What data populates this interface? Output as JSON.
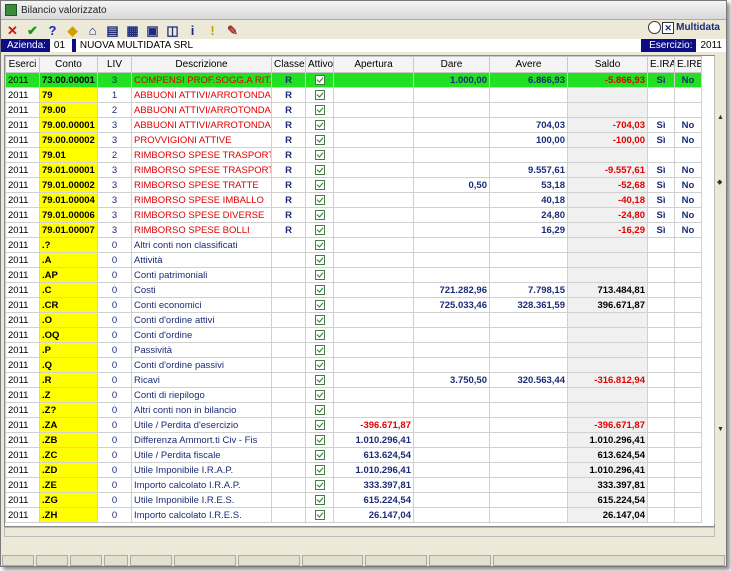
{
  "window": {
    "title": "Bilancio valorizzato"
  },
  "toolbar": {
    "buttons": [
      {
        "name": "close-icon",
        "glyph": "✕",
        "color": "#e01010"
      },
      {
        "name": "confirm-icon",
        "glyph": "✔",
        "color": "#12a012"
      },
      {
        "name": "help-icon",
        "glyph": "?",
        "color": "#1a2ab0"
      },
      {
        "name": "tools-icon",
        "glyph": "◆",
        "color": "#d0a000"
      },
      {
        "name": "home-icon",
        "glyph": "⌂",
        "color": "#1b2b78"
      },
      {
        "name": "document-icon",
        "glyph": "▤",
        "color": "#1b2b78"
      },
      {
        "name": "report-icon",
        "glyph": "▦",
        "color": "#1b2b78"
      },
      {
        "name": "window-icon",
        "glyph": "▣",
        "color": "#1b2b78"
      },
      {
        "name": "tile-icon",
        "glyph": "◫",
        "color": "#1b2b78"
      },
      {
        "name": "info-icon",
        "glyph": "i",
        "color": "#1b2b78"
      },
      {
        "name": "warning-icon",
        "glyph": "!",
        "color": "#c8a000"
      },
      {
        "name": "edit-icon",
        "glyph": "✎",
        "color": "#a03030"
      }
    ],
    "brand": "Multidata"
  },
  "azienda": {
    "label": "Azienda:",
    "code": "01",
    "name": "NUOVA MULTIDATA SRL",
    "esercizio_label": "Esercizio:",
    "esercizio": "2011"
  },
  "grid": {
    "columns": [
      "Eserci",
      "Conto",
      "LIV",
      "Descrizione",
      "Classe",
      "Attivo",
      "Apertura",
      "Dare",
      "Avere",
      "Saldo",
      "E.IRAP",
      "E.IRES"
    ],
    "rows": [
      {
        "ese": "2011",
        "conto": "73.00.00001",
        "liv": "3",
        "desc": "COMPENSI PROF.SOGG.A RIT.ACCONT",
        "desc_red": true,
        "classe": "R",
        "apertura": "",
        "dare": "1.000,00",
        "avere": "6.866,93",
        "saldo": "-5.866,93",
        "saldo_red": true,
        "irap": "Sì",
        "ires": "No",
        "selected": true
      },
      {
        "ese": "2011",
        "conto": "79",
        "liv": "1",
        "desc": "ABBUONI ATTIVI/ARROTONDAMENTI",
        "desc_red": true,
        "classe": "R",
        "apertura": "",
        "dare": "",
        "avere": "",
        "saldo": "",
        "saldo_red": false,
        "irap": "",
        "ires": "",
        "selected": false
      },
      {
        "ese": "2011",
        "conto": "79.00",
        "liv": "2",
        "desc": "ABBUONI ATTIVI/ARROTONDAMENTI",
        "desc_red": true,
        "classe": "R",
        "apertura": "",
        "dare": "",
        "avere": "",
        "saldo": "",
        "saldo_red": false,
        "irap": "",
        "ires": "",
        "selected": false
      },
      {
        "ese": "2011",
        "conto": "79.00.00001",
        "liv": "3",
        "desc": "ABBUONI ATTIVI/ARROTONDAMENTI",
        "desc_red": true,
        "classe": "R",
        "apertura": "",
        "dare": "",
        "avere": "704,03",
        "saldo": "-704,03",
        "saldo_red": true,
        "irap": "Sì",
        "ires": "No",
        "selected": false
      },
      {
        "ese": "2011",
        "conto": "79.00.00002",
        "liv": "3",
        "desc": "PROVVIGIONI ATTIVE",
        "desc_red": true,
        "classe": "R",
        "apertura": "",
        "dare": "",
        "avere": "100,00",
        "saldo": "-100,00",
        "saldo_red": true,
        "irap": "Sì",
        "ires": "No",
        "selected": false
      },
      {
        "ese": "2011",
        "conto": "79.01",
        "liv": "2",
        "desc": "RIMBORSO SPESE TRASPORTO",
        "desc_red": true,
        "classe": "R",
        "apertura": "",
        "dare": "",
        "avere": "",
        "saldo": "",
        "saldo_red": false,
        "irap": "",
        "ires": "",
        "selected": false
      },
      {
        "ese": "2011",
        "conto": "79.01.00001",
        "liv": "3",
        "desc": "RIMBORSO SPESE TRASPORTO",
        "desc_red": true,
        "classe": "R",
        "apertura": "",
        "dare": "",
        "avere": "9.557,61",
        "saldo": "-9.557,61",
        "saldo_red": true,
        "irap": "Sì",
        "ires": "No",
        "selected": false
      },
      {
        "ese": "2011",
        "conto": "79.01.00002",
        "liv": "3",
        "desc": "RIMBORSO SPESE TRATTE",
        "desc_red": true,
        "classe": "R",
        "apertura": "",
        "dare": "0,50",
        "avere": "53,18",
        "saldo": "-52,68",
        "saldo_red": true,
        "irap": "Sì",
        "ires": "No",
        "selected": false
      },
      {
        "ese": "2011",
        "conto": "79.01.00004",
        "liv": "3",
        "desc": "RIMBORSO SPESE IMBALLO",
        "desc_red": true,
        "classe": "R",
        "apertura": "",
        "dare": "",
        "avere": "40,18",
        "saldo": "-40,18",
        "saldo_red": true,
        "irap": "Sì",
        "ires": "No",
        "selected": false
      },
      {
        "ese": "2011",
        "conto": "79.01.00006",
        "liv": "3",
        "desc": "RIMBORSO SPESE DIVERSE",
        "desc_red": true,
        "classe": "R",
        "apertura": "",
        "dare": "",
        "avere": "24,80",
        "saldo": "-24,80",
        "saldo_red": true,
        "irap": "Sì",
        "ires": "No",
        "selected": false
      },
      {
        "ese": "2011",
        "conto": "79.01.00007",
        "liv": "3",
        "desc": "RIMBORSO SPESE BOLLI",
        "desc_red": true,
        "classe": "R",
        "apertura": "",
        "dare": "",
        "avere": "16,29",
        "saldo": "-16,29",
        "saldo_red": true,
        "irap": "Sì",
        "ires": "No",
        "selected": false
      },
      {
        "ese": "2011",
        "conto": ".?",
        "liv": "0",
        "desc": "Altri conti non classificati",
        "desc_red": false,
        "classe": "",
        "apertura": "",
        "dare": "",
        "avere": "",
        "saldo": "",
        "saldo_red": false,
        "irap": "",
        "ires": "",
        "selected": false
      },
      {
        "ese": "2011",
        "conto": ".A",
        "liv": "0",
        "desc": "Attività",
        "desc_red": false,
        "classe": "",
        "apertura": "",
        "dare": "",
        "avere": "",
        "saldo": "",
        "saldo_red": false,
        "irap": "",
        "ires": "",
        "selected": false
      },
      {
        "ese": "2011",
        "conto": ".AP",
        "liv": "0",
        "desc": "Conti patrimoniali",
        "desc_red": false,
        "classe": "",
        "apertura": "",
        "dare": "",
        "avere": "",
        "saldo": "",
        "saldo_red": false,
        "irap": "",
        "ires": "",
        "selected": false
      },
      {
        "ese": "2011",
        "conto": ".C",
        "liv": "0",
        "desc": "Costi",
        "desc_red": false,
        "classe": "",
        "apertura": "",
        "dare": "721.282,96",
        "avere": "7.798,15",
        "saldo": "713.484,81",
        "saldo_red": false,
        "irap": "",
        "ires": "",
        "selected": false
      },
      {
        "ese": "2011",
        "conto": ".CR",
        "liv": "0",
        "desc": "Conti economici",
        "desc_red": false,
        "classe": "",
        "apertura": "",
        "dare": "725.033,46",
        "avere": "328.361,59",
        "saldo": "396.671,87",
        "saldo_red": false,
        "irap": "",
        "ires": "",
        "selected": false
      },
      {
        "ese": "2011",
        "conto": ".O",
        "liv": "0",
        "desc": "Conti d'ordine attivi",
        "desc_red": false,
        "classe": "",
        "apertura": "",
        "dare": "",
        "avere": "",
        "saldo": "",
        "saldo_red": false,
        "irap": "",
        "ires": "",
        "selected": false
      },
      {
        "ese": "2011",
        "conto": ".OQ",
        "liv": "0",
        "desc": "Conti d'ordine",
        "desc_red": false,
        "classe": "",
        "apertura": "",
        "dare": "",
        "avere": "",
        "saldo": "",
        "saldo_red": false,
        "irap": "",
        "ires": "",
        "selected": false
      },
      {
        "ese": "2011",
        "conto": ".P",
        "liv": "0",
        "desc": "Passività",
        "desc_red": false,
        "classe": "",
        "apertura": "",
        "dare": "",
        "avere": "",
        "saldo": "",
        "saldo_red": false,
        "irap": "",
        "ires": "",
        "selected": false
      },
      {
        "ese": "2011",
        "conto": ".Q",
        "liv": "0",
        "desc": "Conti d'ordine passivi",
        "desc_red": false,
        "classe": "",
        "apertura": "",
        "dare": "",
        "avere": "",
        "saldo": "",
        "saldo_red": false,
        "irap": "",
        "ires": "",
        "selected": false
      },
      {
        "ese": "2011",
        "conto": ".R",
        "liv": "0",
        "desc": "Ricavi",
        "desc_red": false,
        "classe": "",
        "apertura": "",
        "dare": "3.750,50",
        "avere": "320.563,44",
        "saldo": "-316.812,94",
        "saldo_red": true,
        "irap": "",
        "ires": "",
        "selected": false
      },
      {
        "ese": "2011",
        "conto": ".Z",
        "liv": "0",
        "desc": "Conti di riepilogo",
        "desc_red": false,
        "classe": "",
        "apertura": "",
        "dare": "",
        "avere": "",
        "saldo": "",
        "saldo_red": false,
        "irap": "",
        "ires": "",
        "selected": false
      },
      {
        "ese": "2011",
        "conto": ".Z?",
        "liv": "0",
        "desc": "Altri conti non in bilancio",
        "desc_red": false,
        "classe": "",
        "apertura": "",
        "dare": "",
        "avere": "",
        "saldo": "",
        "saldo_red": false,
        "irap": "",
        "ires": "",
        "selected": false
      },
      {
        "ese": "2011",
        "conto": ".ZA",
        "liv": "0",
        "desc": "Utile / Perdita d'esercizio",
        "desc_red": false,
        "classe": "",
        "apertura": "-396.671,87",
        "dare": "",
        "avere": "",
        "saldo": "-396.671,87",
        "saldo_red": true,
        "irap": "",
        "ires": "",
        "selected": false
      },
      {
        "ese": "2011",
        "conto": ".ZB",
        "liv": "0",
        "desc": "Differenza Ammort.ti Civ - Fis",
        "desc_red": false,
        "classe": "",
        "apertura": "1.010.296,41",
        "dare": "",
        "avere": "",
        "saldo": "1.010.296,41",
        "saldo_red": false,
        "irap": "",
        "ires": "",
        "selected": false
      },
      {
        "ese": "2011",
        "conto": ".ZC",
        "liv": "0",
        "desc": "Utile / Perdita fiscale",
        "desc_red": false,
        "classe": "",
        "apertura": "613.624,54",
        "dare": "",
        "avere": "",
        "saldo": "613.624,54",
        "saldo_red": false,
        "irap": "",
        "ires": "",
        "selected": false
      },
      {
        "ese": "2011",
        "conto": ".ZD",
        "liv": "0",
        "desc": "Utile Imponibile I.R.A.P.",
        "desc_red": false,
        "classe": "",
        "apertura": "1.010.296,41",
        "dare": "",
        "avere": "",
        "saldo": "1.010.296,41",
        "saldo_red": false,
        "irap": "",
        "ires": "",
        "selected": false
      },
      {
        "ese": "2011",
        "conto": ".ZE",
        "liv": "0",
        "desc": "Importo calcolato I.R.A.P.",
        "desc_red": false,
        "classe": "",
        "apertura": "333.397,81",
        "dare": "",
        "avere": "",
        "saldo": "333.397,81",
        "saldo_red": false,
        "irap": "",
        "ires": "",
        "selected": false
      },
      {
        "ese": "2011",
        "conto": ".ZG",
        "liv": "0",
        "desc": "Utile Imponibile I.R.E.S.",
        "desc_red": false,
        "classe": "",
        "apertura": "615.224,54",
        "dare": "",
        "avere": "",
        "saldo": "615.224,54",
        "saldo_red": false,
        "irap": "",
        "ires": "",
        "selected": false
      },
      {
        "ese": "2011",
        "conto": ".ZH",
        "liv": "0",
        "desc": "Importo calcolato I.R.E.S.",
        "desc_red": false,
        "classe": "",
        "apertura": "26.147,04",
        "dare": "",
        "avere": "",
        "saldo": "26.147,04",
        "saldo_red": false,
        "irap": "",
        "ires": "",
        "selected": false
      }
    ]
  },
  "colors": {
    "accent_bar": "#0c0c84",
    "conto_highlight": "#ffff00",
    "selected_row": "#22e022",
    "negative": "#e00000",
    "text_blue": "#1b2b78"
  }
}
